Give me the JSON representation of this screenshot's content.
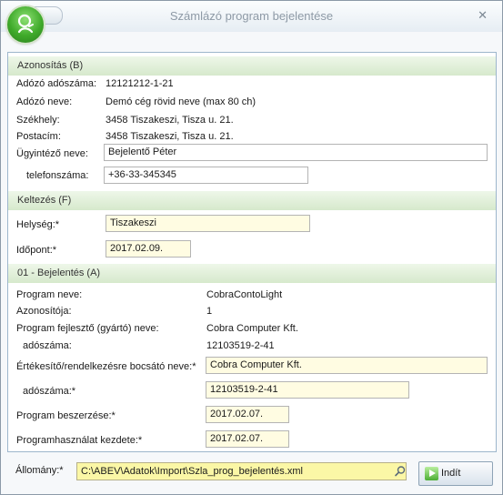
{
  "window": {
    "title": "Számlázó program bejelentése",
    "close_glyph": "✕",
    "accent": "#3faa2a",
    "header_green": "#d6e9cc"
  },
  "section_a": {
    "header": "Azonosítás (B)",
    "tax_number_label": "Adózó adószáma:",
    "tax_number": "12121212-1-21",
    "name_label": "Adózó neve:",
    "name": "Demó cég rövid neve (max 80 ch)",
    "seat_label": "Székhely:",
    "seat": "3458 Tiszakeszi, Tisza u. 21.",
    "postal_label": "Postacím:",
    "postal": "3458 Tiszakeszi, Tisza u. 21.",
    "clerk_label": "Ügyintéző neve:",
    "clerk_value": "Bejelentő Péter",
    "phone_label": "telefonszáma:",
    "phone_value": "+36-33-345345"
  },
  "section_b": {
    "header": "Keltezés (F)",
    "place_label": "Helység:*",
    "place_value": "Tiszakeszi",
    "date_label": "Időpont:*",
    "date_value": "2017.02.09."
  },
  "section_c": {
    "header": "01 - Bejelentés (A)",
    "program_name_label": "Program neve:",
    "program_name": "CobraContoLight",
    "program_id_label": "Azonosítója:",
    "program_id": "1",
    "developer_label": "Program fejlesztő (gyártó) neve:",
    "developer": "Cobra Computer Kft.",
    "developer_tax_label": "adószáma:",
    "developer_tax": "12103519-2-41",
    "seller_label": "Értékesítő/rendelkezésre bocsátó neve:*",
    "seller_value": "Cobra Computer Kft.",
    "seller_tax_label": "adószáma:*",
    "seller_tax_value": "12103519-2-41",
    "purchase_label": "Program beszerzése:*",
    "purchase_value": "2017.02.07.",
    "usage_start_label": "Programhasználat kezdete:*",
    "usage_start_value": "2017.02.07."
  },
  "footer": {
    "file_label": "Állomány:*",
    "file_value": "C:\\ABEV\\Adatok\\Import\\Szla_prog_bejelentés.xml",
    "start_label": "Indít",
    "icons": [
      "search-icon",
      "play-icon"
    ]
  }
}
